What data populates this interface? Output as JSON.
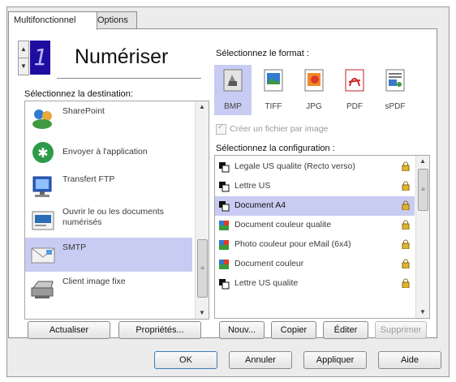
{
  "tabs": [
    {
      "label": "Multifonctionnel"
    },
    {
      "label": "Options"
    }
  ],
  "counter": {
    "value": "1"
  },
  "title": "Numériser",
  "destination": {
    "label": "Sélectionnez la destination:",
    "items": [
      {
        "label": "SharePoint",
        "icon": "sharepoint-icon"
      },
      {
        "label": "Envoyer à l'application",
        "icon": "send-to-application-icon"
      },
      {
        "label": "Transfert FTP",
        "icon": "ftp-transfer-icon"
      },
      {
        "label": "Ouvrir le ou les documents numérisés",
        "icon": "open-documents-icon"
      },
      {
        "label": "SMTP",
        "icon": "smtp-email-icon"
      },
      {
        "label": "Client image fixe",
        "icon": "still-image-client-icon"
      }
    ],
    "selected_index": 4
  },
  "format": {
    "label": "Sélectionnez le format :",
    "items": [
      {
        "label": "BMP",
        "icon": "bmp-format-icon"
      },
      {
        "label": "TIFF",
        "icon": "tiff-format-icon"
      },
      {
        "label": "JPG",
        "icon": "jpg-format-icon"
      },
      {
        "label": "PDF",
        "icon": "pdf-format-icon"
      },
      {
        "label": "sPDF",
        "icon": "spdf-format-icon"
      }
    ],
    "selected_index": 0
  },
  "one_file_checkbox": {
    "label": "Créer un fichier par image",
    "checked": true,
    "enabled": false
  },
  "configuration": {
    "label": "Sélectionnez la configuration :",
    "items": [
      {
        "label": "Legale US qualite (Recto verso)",
        "mode": "black-white"
      },
      {
        "label": "Lettre US",
        "mode": "black-white"
      },
      {
        "label": "Document A4",
        "mode": "black-white"
      },
      {
        "label": "Document couleur qualite",
        "mode": "color"
      },
      {
        "label": "Photo couleur pour eMail (6x4)",
        "mode": "color"
      },
      {
        "label": "Document couleur",
        "mode": "color"
      },
      {
        "label": "Lettre US qualite",
        "mode": "black-white"
      }
    ],
    "selected_index": 2
  },
  "buttons": {
    "refresh": "Actualiser",
    "properties": "Propriétés...",
    "new": "Nouv...",
    "copy": "Copier",
    "edit": "Éditer",
    "delete": "Supprimer",
    "ok": "OK",
    "cancel": "Annuler",
    "apply": "Appliquer",
    "help": "Aide"
  },
  "colors": {
    "selection": "#c8ccf2",
    "counter_background": "#1e0ea0",
    "lock": "#e0b430"
  }
}
